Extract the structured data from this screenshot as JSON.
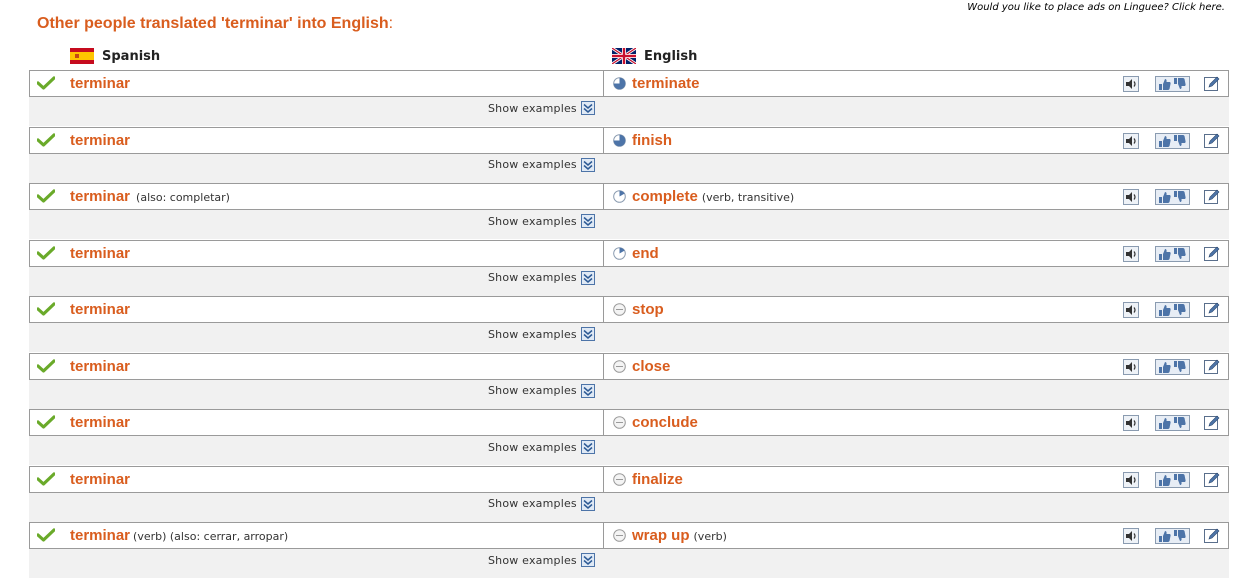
{
  "ads_link": "Would you like to place ads on Linguee? Click here.",
  "title": "Other people translated 'terminar' into English",
  "title_colon": ":",
  "lang_source": "Spanish",
  "lang_target": "English",
  "show_examples_label": "Show examples",
  "colors": {
    "accent": "#d95d1e",
    "check": "#6aaa2a",
    "icon_blue": "#4d74a8"
  },
  "entries": [
    {
      "source": "terminar",
      "source_note": "",
      "target": "terminate",
      "target_note": "",
      "freq": "high"
    },
    {
      "source": "terminar",
      "source_note": "",
      "target": "finish",
      "target_note": "",
      "freq": "high"
    },
    {
      "source": "terminar",
      "source_note": "(also: completar)",
      "target": "complete",
      "target_note": "(verb, transitive)",
      "freq": "medium"
    },
    {
      "source": "terminar",
      "source_note": "",
      "target": "end",
      "target_note": "",
      "freq": "medium"
    },
    {
      "source": "terminar",
      "source_note": "",
      "target": "stop",
      "target_note": "",
      "freq": "low"
    },
    {
      "source": "terminar",
      "source_note": "",
      "target": "close",
      "target_note": "",
      "freq": "low"
    },
    {
      "source": "terminar",
      "source_note": "",
      "target": "conclude",
      "target_note": "",
      "freq": "low"
    },
    {
      "source": "terminar",
      "source_note": "",
      "target": "finalize",
      "target_note": "",
      "freq": "low"
    },
    {
      "source": "terminar",
      "source_note": "(verb) (also: cerrar, arropar)",
      "target": "wrap up",
      "target_note": "(verb)",
      "freq": "low"
    }
  ]
}
